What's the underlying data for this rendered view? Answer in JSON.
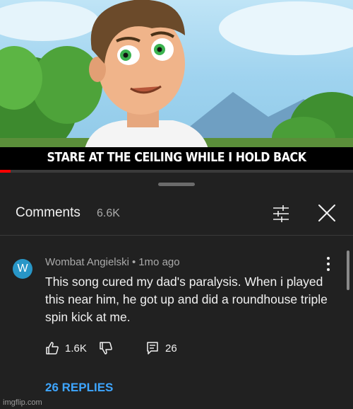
{
  "video": {
    "caption": "STARE AT THE CEILING WHILE I HOLD BACK",
    "progress_fraction": 0.03
  },
  "comments_panel": {
    "title": "Comments",
    "count": "6.6K"
  },
  "comment": {
    "avatar_letter": "W",
    "author": "Wombat Angielski",
    "separator": "•",
    "time": "1mo ago",
    "text": "This song cured my dad's paralysis. When i played this near him, he got up and did a roundhouse triple spin kick at me.",
    "likes": "1.6K",
    "reply_count": "26",
    "replies_label": "26 REPLIES"
  },
  "colors": {
    "accent_link": "#3ea6ff",
    "avatar": "#2896c7",
    "progress": "#ff0000"
  },
  "icons": [
    "filter-icon",
    "close-icon",
    "kebab-menu-icon",
    "thumbs-up-icon",
    "thumbs-down-icon",
    "reply-icon"
  ],
  "watermark": "imgflip.com"
}
